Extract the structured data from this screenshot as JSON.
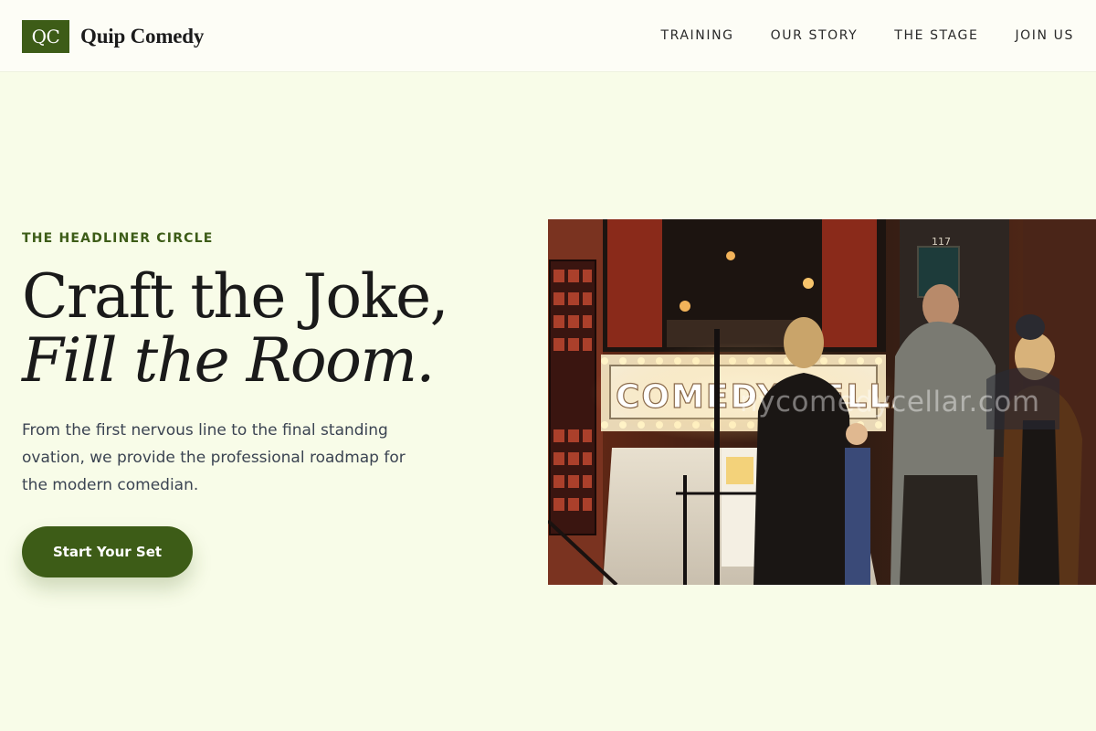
{
  "brand": {
    "logo_text": "QC",
    "name": "Quip Comedy",
    "logo_color": "#3d5c17"
  },
  "nav": {
    "items": [
      {
        "label": "TRAINING"
      },
      {
        "label": "OUR STORY"
      },
      {
        "label": "THE STAGE"
      },
      {
        "label": "JOIN US"
      }
    ]
  },
  "hero": {
    "eyebrow": "THE HEADLINER CIRCLE",
    "headline_line1": "Craft the Joke,",
    "headline_line2": "Fill the Room.",
    "lead": "From the first nervous line to the final standing ovation, we provide the professional roadmap for the modern comedian.",
    "cta_label": "Start Your Set",
    "image": {
      "sign_text": "COMEDY CELLAR",
      "watermark": "nycomedycellar.com",
      "door_number": "117"
    }
  },
  "colors": {
    "page_background": "#f8fce8",
    "header_background": "#fdfdf6",
    "accent": "#3d5c17",
    "heading": "#1a1a1a",
    "body_text": "#3b4452"
  }
}
